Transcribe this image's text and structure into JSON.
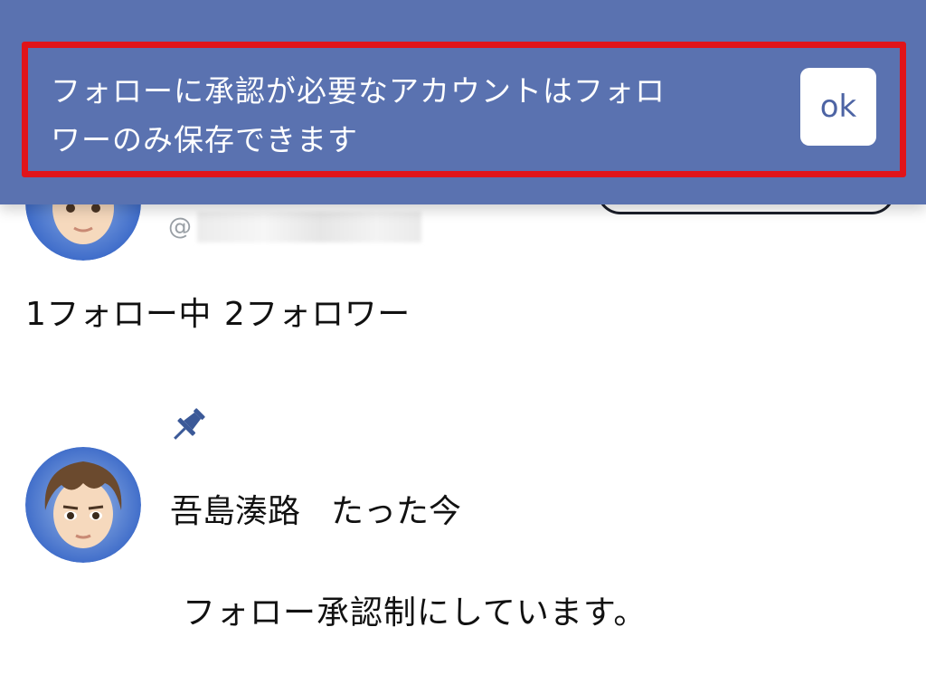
{
  "banner": {
    "message_line1": "フォローに承認が必要なアカウントはフォロ",
    "message_line2": "ワーのみ保存できます",
    "ok_label": "ok"
  },
  "profile": {
    "handle_prefix": "@",
    "following_text": "1フォロー中",
    "followers_text": "2フォロワー"
  },
  "pinned_post": {
    "icon": "pin-icon",
    "author": "吾島湊路",
    "time": "たった今",
    "body": "フォロー承認制にしています。"
  },
  "colors": {
    "banner_bg": "#5a72b0",
    "highlight_border": "#e0141a",
    "ok_text": "#4d64a4",
    "pin": "#3b5998"
  }
}
